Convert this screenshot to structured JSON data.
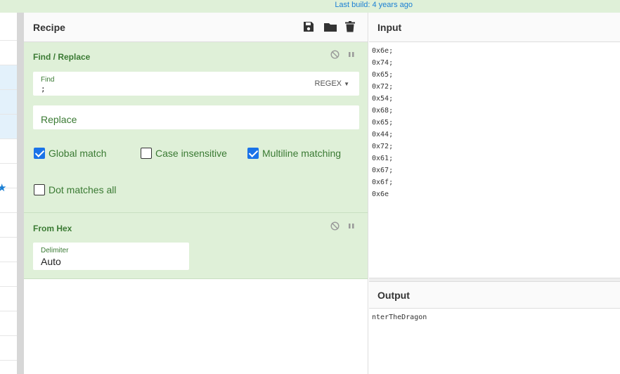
{
  "topbar": {
    "build_text": "Last build: 4 years ago"
  },
  "recipe": {
    "title": "Recipe",
    "tools": [
      "save-icon",
      "folder-icon",
      "trash-icon"
    ],
    "operations": {
      "find_replace": {
        "title": "Find / Replace",
        "find_label": "Find",
        "find_value": ";",
        "find_mode": "REGEX",
        "replace_placeholder": "Replace",
        "options": [
          {
            "label": "Global match",
            "checked": true
          },
          {
            "label": "Case insensitive",
            "checked": false
          },
          {
            "label": "Multiline matching",
            "checked": true
          },
          {
            "label": "Dot matches all",
            "checked": false
          }
        ]
      },
      "from_hex": {
        "title": "From Hex",
        "delimiter_label": "Delimiter",
        "delimiter_value": "Auto"
      }
    }
  },
  "input": {
    "title": "Input",
    "text": "0x6e;\n0x74;\n0x65;\n0x72;\n0x54;\n0x68;\n0x65;\n0x44;\n0x72;\n0x61;\n0x67;\n0x6f;\n0x6e"
  },
  "output": {
    "title": "Output",
    "text": "nterTheDragon"
  }
}
